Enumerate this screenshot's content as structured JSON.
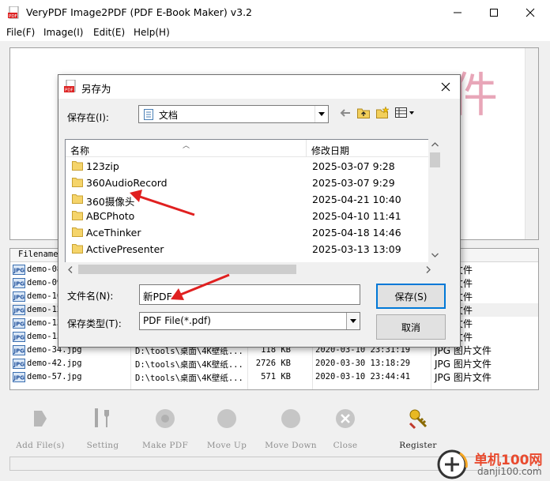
{
  "window": {
    "title": "VeryPDF Image2PDF (PDF E-Book Maker) v3.2"
  },
  "menu": [
    "File(F)",
    "Image(I)",
    "Edit(E)",
    "Help(H)"
  ],
  "preview": {
    "text": "件"
  },
  "file_list": {
    "header_name": "Filename",
    "rows": [
      {
        "name": "demo-08",
        "path": "",
        "size": "",
        "date": "",
        "type": "图片文件"
      },
      {
        "name": "demo-09",
        "path": "",
        "size": "",
        "date": "",
        "type": "图片文件"
      },
      {
        "name": "demo-10",
        "path": "",
        "size": "",
        "date": "",
        "type": "图片文件"
      },
      {
        "name": "demo-12",
        "path": "",
        "size": "",
        "date": "",
        "type": "图片文件"
      },
      {
        "name": "demo-13",
        "path": "",
        "size": "",
        "date": "",
        "type": "图片文件"
      },
      {
        "name": "demo-15",
        "path": "",
        "size": "",
        "date": "",
        "type": "图片文件"
      },
      {
        "name": "demo-34.jpg",
        "path": "D:\\tools\\桌面\\4K壁纸...",
        "size": "118 KB",
        "date": "2020-03-10 23:31:19",
        "type": "JPG 图片文件"
      },
      {
        "name": "demo-42.jpg",
        "path": "D:\\tools\\桌面\\4K壁纸...",
        "size": "2726 KB",
        "date": "2020-03-30 13:18:29",
        "type": "JPG 图片文件"
      },
      {
        "name": "demo-57.jpg",
        "path": "D:\\tools\\桌面\\4K壁纸...",
        "size": "571 KB",
        "date": "2020-03-10 23:44:41",
        "type": "JPG 图片文件"
      }
    ]
  },
  "toolbar": [
    {
      "label": "Add File(s)",
      "icon": "add-file-icon"
    },
    {
      "label": "Setting",
      "icon": "tools-icon"
    },
    {
      "label": "Make PDF",
      "icon": "make-pdf-icon"
    },
    {
      "label": "Move Up",
      "icon": "move-up-icon"
    },
    {
      "label": "Move Down",
      "icon": "move-down-icon"
    },
    {
      "label": "Close",
      "icon": "close-icon"
    },
    {
      "label": "Register",
      "icon": "key-icon"
    }
  ],
  "watermark": {
    "brand": "单机100网",
    "url": "danji100.com"
  },
  "dialog": {
    "title": "另存为",
    "save_in_label": "保存在(I):",
    "save_in_value": "文档",
    "columns": {
      "name": "名称",
      "date": "修改日期"
    },
    "folders": [
      {
        "name": "123zip",
        "date": "2025-03-07 9:28"
      },
      {
        "name": "360AudioRecord",
        "date": "2025-03-07 9:29"
      },
      {
        "name": "360摄像头",
        "date": "2025-04-21 10:40"
      },
      {
        "name": "ABCPhoto",
        "date": "2025-04-10 11:41"
      },
      {
        "name": "AceThinker",
        "date": "2025-04-18 14:46"
      },
      {
        "name": "ActivePresenter",
        "date": "2025-03-13 13:09"
      }
    ],
    "filename_label": "文件名(N):",
    "filename_value": "新PDF",
    "filetype_label": "保存类型(T):",
    "filetype_value": "PDF File(*.pdf)",
    "save_button": "保存(S)",
    "cancel_button": "取消"
  },
  "colors": {
    "accent_border": "#0078d7",
    "annotation_arrow": "#e02020",
    "watermark_brand": "#e94a2e"
  }
}
